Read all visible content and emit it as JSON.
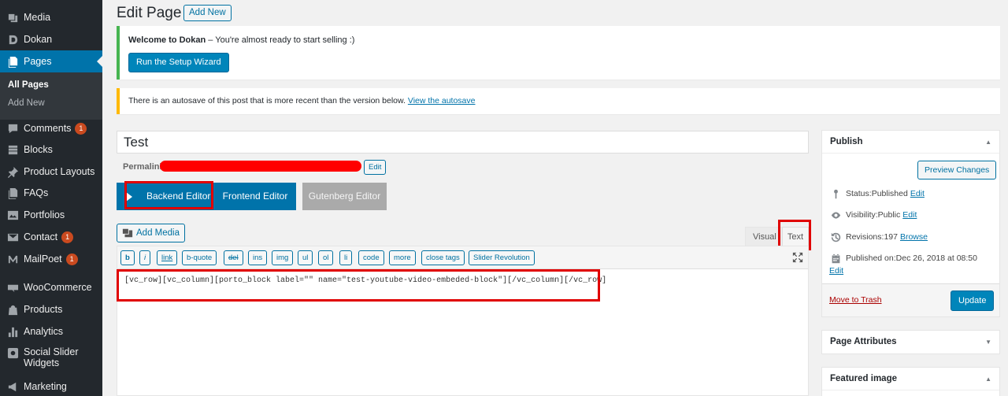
{
  "sidebar": {
    "items": [
      {
        "label": "Media",
        "icon": "media-icon"
      },
      {
        "label": "Dokan",
        "icon": "dokan-icon"
      },
      {
        "label": "Pages",
        "icon": "pages-icon"
      },
      {
        "label": "Comments",
        "icon": "comments-icon",
        "badge": "1"
      },
      {
        "label": "Blocks",
        "icon": "blocks-icon"
      },
      {
        "label": "Product Layouts",
        "icon": "pin-icon"
      },
      {
        "label": "FAQs",
        "icon": "faqs-icon"
      },
      {
        "label": "Portfolios",
        "icon": "portfolios-icon"
      },
      {
        "label": "Contact",
        "icon": "contact-icon",
        "badge": "1"
      },
      {
        "label": "MailPoet",
        "icon": "mailpoet-icon",
        "badge": "1"
      },
      {
        "label": "WooCommerce",
        "icon": "woocommerce-icon"
      },
      {
        "label": "Products",
        "icon": "products-icon"
      },
      {
        "label": "Analytics",
        "icon": "analytics-icon"
      },
      {
        "label": "Social Slider Widgets",
        "icon": "instagram-icon"
      },
      {
        "label": "Marketing",
        "icon": "marketing-icon"
      }
    ],
    "submenu": [
      "All Pages",
      "Add New"
    ]
  },
  "header": {
    "title": "Edit Page",
    "add_new": "Add New"
  },
  "notices": {
    "welcome_bold": "Welcome to Dokan",
    "welcome_rest": " – You're almost ready to start selling :)",
    "wizard_button": "Run the Setup Wizard",
    "autosave_text": "There is an autosave of this post that is more recent than the version below. ",
    "autosave_link": "View the autosave"
  },
  "post": {
    "title": "Test",
    "permalink_label": "Permalink",
    "permalink_edit": "Edit"
  },
  "composer": {
    "backend": "Backend Editor",
    "frontend": "Frontend Editor",
    "gutenberg": "Gutenberg Editor"
  },
  "editor": {
    "add_media": "Add Media",
    "tab_visual": "Visual",
    "tab_text": "Text",
    "quicktags": [
      "b",
      "i",
      "link",
      "b-quote",
      "del",
      "ins",
      "img",
      "ul",
      "ol",
      "li",
      "code",
      "more",
      "close tags",
      "Slider Revolution"
    ],
    "content": "[vc_row][vc_column][porto_block label=\"\" name=\"test-youtube-video-embeded-block\"][/vc_column][/vc_row]"
  },
  "publish": {
    "title": "Publish",
    "preview": "Preview Changes",
    "status_label": "Status: ",
    "status_value": "Published",
    "visibility_label": "Visibility: ",
    "visibility_value": "Public",
    "revisions_label": "Revisions: ",
    "revisions_value": "197",
    "browse": "Browse",
    "published_on_label": "Published on: ",
    "published_on_value": "Dec 26, 2018 at 08:50",
    "edit": "Edit",
    "trash": "Move to Trash",
    "update": "Update"
  },
  "page_attributes": {
    "title": "Page Attributes"
  },
  "featured_image": {
    "title": "Featured image"
  },
  "colors": {
    "accent": "#0073aa",
    "sidebar": "#23282d",
    "highlight": "#e00000",
    "redaction": "#ff0000"
  }
}
